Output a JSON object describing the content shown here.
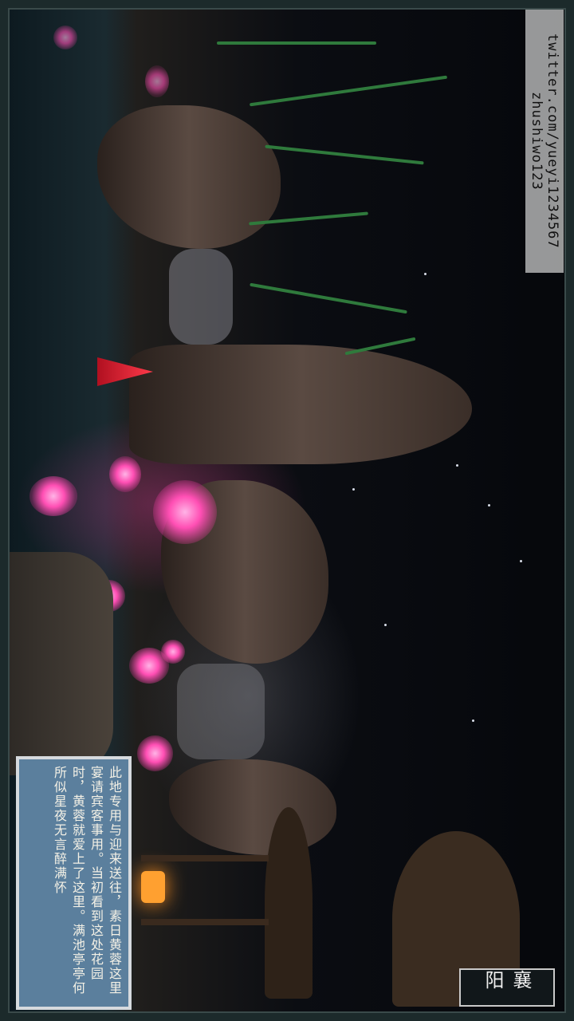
{
  "watermark": {
    "line1": "zhushiwo123",
    "line2": "twitter.com/yueyi1234567"
  },
  "info": {
    "text": "此地专用与迎来送往，素日黄蓉这里宴请宾客事用。当初看到这处花园时，黄蓉就爱上了这里。满池亭亭何所似星夜无言醉满怀"
  },
  "location": {
    "name": "襄阳"
  }
}
